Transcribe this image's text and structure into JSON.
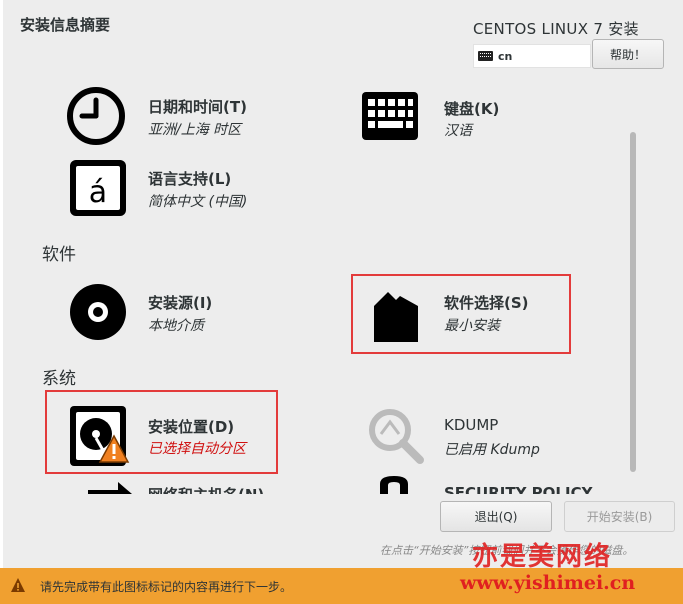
{
  "header": {
    "title": "安装信息摘要",
    "product": "CENTOS LINUX 7 安装",
    "keyboard_layout": "cn",
    "help_label": "帮助！"
  },
  "sections": {
    "software": "软件",
    "system": "系统"
  },
  "spokes": {
    "datetime": {
      "title": "日期和时间(T)",
      "status": "亚洲/上海 时区"
    },
    "keyboard": {
      "title": "键盘(K)",
      "status": "汉语"
    },
    "language": {
      "title": "语言支持(L)",
      "status": "简体中文 (中国)"
    },
    "source": {
      "title": "安装源(I)",
      "status": "本地介质"
    },
    "software": {
      "title": "软件选择(S)",
      "status": "最小安装"
    },
    "destination": {
      "title": "安装位置(D)",
      "status": "已选择自动分区"
    },
    "kdump": {
      "title": "KDUMP",
      "status": "已启用 Kdump"
    },
    "network": {
      "title": "网络和主机名(N)"
    },
    "security": {
      "title": "SECURITY POLICY"
    }
  },
  "buttons": {
    "quit_label": "退出(Q)",
    "begin_label": "开始安装(B)"
  },
  "hint": "在点击“开始安装”按钮前我们并不会操作您的磁盘。",
  "footer": {
    "message": "请先完成带有此图标标记的内容再进行下一步。"
  },
  "watermark": {
    "site": "亦是美网络",
    "url": "www.yishimei.cn"
  },
  "colors": {
    "footer_bg": "#f0a030",
    "warning_text": "#d01010",
    "highlight_border": "#e33b3b"
  }
}
